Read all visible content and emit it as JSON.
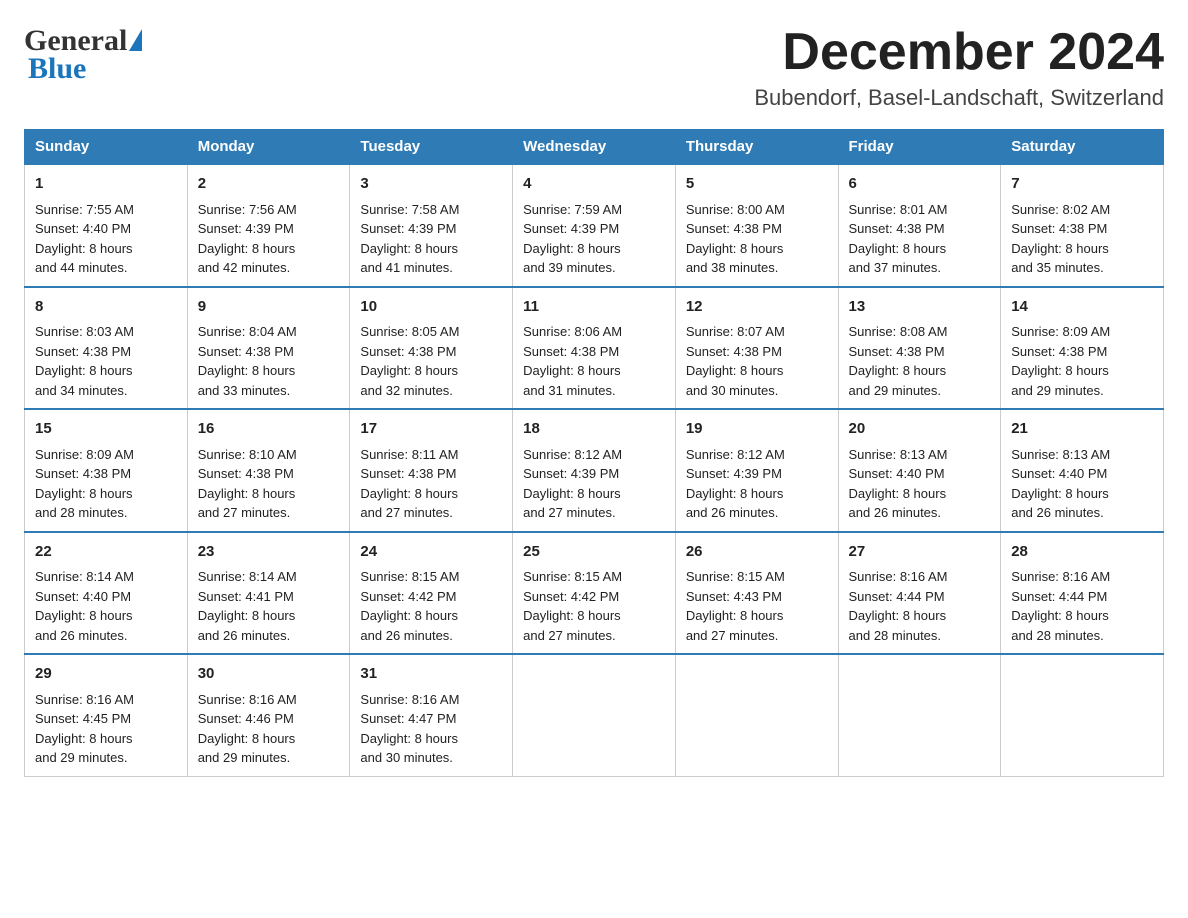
{
  "header": {
    "logo_text_general": "General",
    "logo_text_blue": "Blue",
    "month_title": "December 2024",
    "location": "Bubendorf, Basel-Landschaft, Switzerland"
  },
  "days_of_week": [
    "Sunday",
    "Monday",
    "Tuesday",
    "Wednesday",
    "Thursday",
    "Friday",
    "Saturday"
  ],
  "weeks": [
    [
      {
        "day": "1",
        "sunrise": "7:55 AM",
        "sunset": "4:40 PM",
        "daylight": "8 hours and 44 minutes."
      },
      {
        "day": "2",
        "sunrise": "7:56 AM",
        "sunset": "4:39 PM",
        "daylight": "8 hours and 42 minutes."
      },
      {
        "day": "3",
        "sunrise": "7:58 AM",
        "sunset": "4:39 PM",
        "daylight": "8 hours and 41 minutes."
      },
      {
        "day": "4",
        "sunrise": "7:59 AM",
        "sunset": "4:39 PM",
        "daylight": "8 hours and 39 minutes."
      },
      {
        "day": "5",
        "sunrise": "8:00 AM",
        "sunset": "4:38 PM",
        "daylight": "8 hours and 38 minutes."
      },
      {
        "day": "6",
        "sunrise": "8:01 AM",
        "sunset": "4:38 PM",
        "daylight": "8 hours and 37 minutes."
      },
      {
        "day": "7",
        "sunrise": "8:02 AM",
        "sunset": "4:38 PM",
        "daylight": "8 hours and 35 minutes."
      }
    ],
    [
      {
        "day": "8",
        "sunrise": "8:03 AM",
        "sunset": "4:38 PM",
        "daylight": "8 hours and 34 minutes."
      },
      {
        "day": "9",
        "sunrise": "8:04 AM",
        "sunset": "4:38 PM",
        "daylight": "8 hours and 33 minutes."
      },
      {
        "day": "10",
        "sunrise": "8:05 AM",
        "sunset": "4:38 PM",
        "daylight": "8 hours and 32 minutes."
      },
      {
        "day": "11",
        "sunrise": "8:06 AM",
        "sunset": "4:38 PM",
        "daylight": "8 hours and 31 minutes."
      },
      {
        "day": "12",
        "sunrise": "8:07 AM",
        "sunset": "4:38 PM",
        "daylight": "8 hours and 30 minutes."
      },
      {
        "day": "13",
        "sunrise": "8:08 AM",
        "sunset": "4:38 PM",
        "daylight": "8 hours and 29 minutes."
      },
      {
        "day": "14",
        "sunrise": "8:09 AM",
        "sunset": "4:38 PM",
        "daylight": "8 hours and 29 minutes."
      }
    ],
    [
      {
        "day": "15",
        "sunrise": "8:09 AM",
        "sunset": "4:38 PM",
        "daylight": "8 hours and 28 minutes."
      },
      {
        "day": "16",
        "sunrise": "8:10 AM",
        "sunset": "4:38 PM",
        "daylight": "8 hours and 27 minutes."
      },
      {
        "day": "17",
        "sunrise": "8:11 AM",
        "sunset": "4:38 PM",
        "daylight": "8 hours and 27 minutes."
      },
      {
        "day": "18",
        "sunrise": "8:12 AM",
        "sunset": "4:39 PM",
        "daylight": "8 hours and 27 minutes."
      },
      {
        "day": "19",
        "sunrise": "8:12 AM",
        "sunset": "4:39 PM",
        "daylight": "8 hours and 26 minutes."
      },
      {
        "day": "20",
        "sunrise": "8:13 AM",
        "sunset": "4:40 PM",
        "daylight": "8 hours and 26 minutes."
      },
      {
        "day": "21",
        "sunrise": "8:13 AM",
        "sunset": "4:40 PM",
        "daylight": "8 hours and 26 minutes."
      }
    ],
    [
      {
        "day": "22",
        "sunrise": "8:14 AM",
        "sunset": "4:40 PM",
        "daylight": "8 hours and 26 minutes."
      },
      {
        "day": "23",
        "sunrise": "8:14 AM",
        "sunset": "4:41 PM",
        "daylight": "8 hours and 26 minutes."
      },
      {
        "day": "24",
        "sunrise": "8:15 AM",
        "sunset": "4:42 PM",
        "daylight": "8 hours and 26 minutes."
      },
      {
        "day": "25",
        "sunrise": "8:15 AM",
        "sunset": "4:42 PM",
        "daylight": "8 hours and 27 minutes."
      },
      {
        "day": "26",
        "sunrise": "8:15 AM",
        "sunset": "4:43 PM",
        "daylight": "8 hours and 27 minutes."
      },
      {
        "day": "27",
        "sunrise": "8:16 AM",
        "sunset": "4:44 PM",
        "daylight": "8 hours and 28 minutes."
      },
      {
        "day": "28",
        "sunrise": "8:16 AM",
        "sunset": "4:44 PM",
        "daylight": "8 hours and 28 minutes."
      }
    ],
    [
      {
        "day": "29",
        "sunrise": "8:16 AM",
        "sunset": "4:45 PM",
        "daylight": "8 hours and 29 minutes."
      },
      {
        "day": "30",
        "sunrise": "8:16 AM",
        "sunset": "4:46 PM",
        "daylight": "8 hours and 29 minutes."
      },
      {
        "day": "31",
        "sunrise": "8:16 AM",
        "sunset": "4:47 PM",
        "daylight": "8 hours and 30 minutes."
      },
      null,
      null,
      null,
      null
    ]
  ],
  "labels": {
    "sunrise": "Sunrise:",
    "sunset": "Sunset:",
    "daylight": "Daylight:"
  }
}
